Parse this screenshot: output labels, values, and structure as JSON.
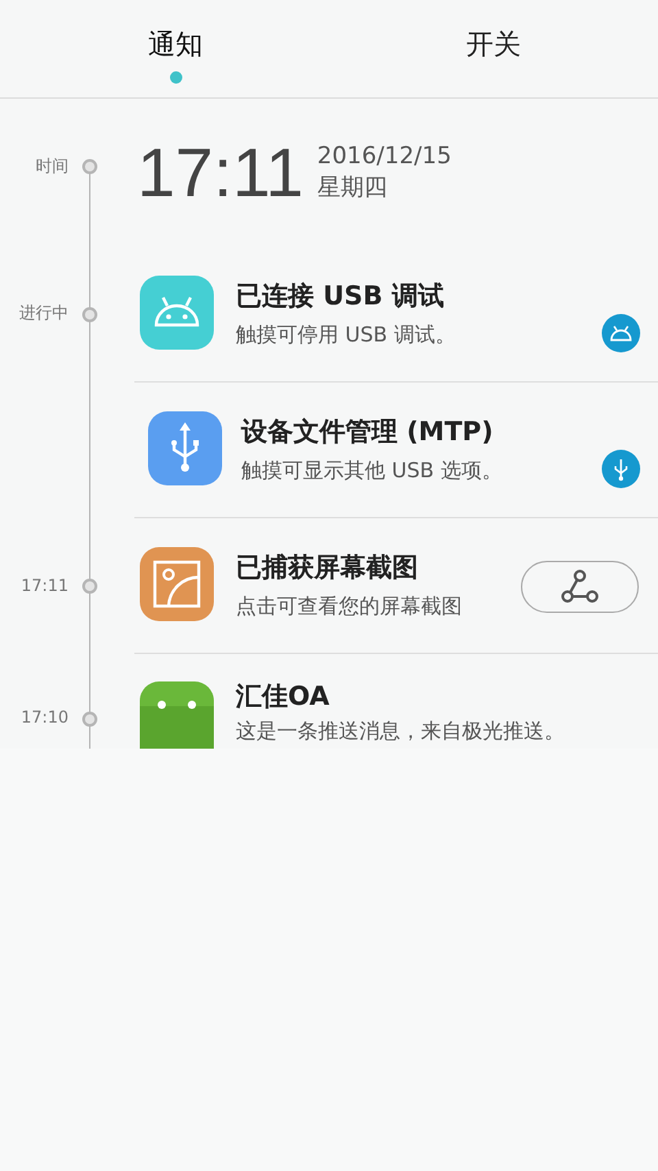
{
  "tabs": [
    {
      "label": "通知",
      "selected": true
    },
    {
      "label": "开关",
      "selected": false
    }
  ],
  "clock": {
    "label": "时间",
    "time": "17:11",
    "date": "2016/12/15",
    "weekday": "星期四"
  },
  "notifications": [
    {
      "label": "进行中",
      "kind": "debug",
      "title": "已连接 USB 调试",
      "text": "触摸可停用 USB 调试。"
    },
    {
      "kind": "usb",
      "title": "设备文件管理 (MTP)",
      "text": "触摸可显示其他 USB 选项。"
    },
    {
      "label": "17:11",
      "kind": "screenshot",
      "title": "已捕获屏幕截图",
      "text": "点击可查看您的屏幕截图"
    },
    {
      "label": "17:10",
      "kind": "push",
      "title": "汇佳OA",
      "text": "这是一条推送消息，来自极光推送。"
    }
  ]
}
